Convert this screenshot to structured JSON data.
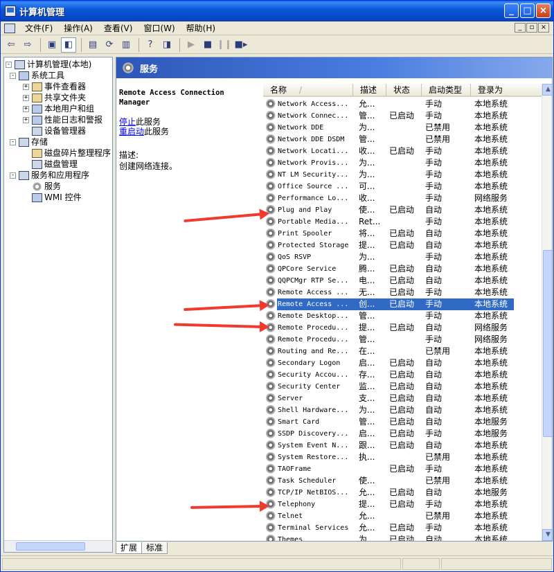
{
  "window": {
    "title": "计算机管理",
    "min": "_",
    "max": "□",
    "close": "×"
  },
  "menu": {
    "items": [
      "文件(F)",
      "操作(A)",
      "查看(V)",
      "窗口(W)",
      "帮助(H)"
    ],
    "mdi": [
      "_",
      "▫",
      "×"
    ]
  },
  "toolbar": {
    "icons": [
      "back-arrow-icon",
      "forward-arrow-icon",
      "up-folder-icon",
      "show-hide-tree-icon",
      "properties-icon",
      "refresh-icon",
      "export-list-icon",
      "help-icon",
      "description-icon",
      "start-icon",
      "stop-icon",
      "pause-icon",
      "restart-icon"
    ]
  },
  "tree": {
    "items": [
      {
        "label": "计算机管理(本地)",
        "icon": "computer-icon",
        "toggle": "-"
      },
      {
        "label": "系统工具",
        "icon": "tools-icon",
        "toggle": "-"
      },
      {
        "label": "事件查看器",
        "icon": "event-viewer-icon",
        "toggle": "+"
      },
      {
        "label": "共享文件夹",
        "icon": "shared-folder-icon",
        "toggle": "+"
      },
      {
        "label": "本地用户和组",
        "icon": "users-icon",
        "toggle": "+"
      },
      {
        "label": "性能日志和警报",
        "icon": "performance-icon",
        "toggle": "+"
      },
      {
        "label": "设备管理器",
        "icon": "device-manager-icon",
        "toggle": ""
      },
      {
        "label": "存储",
        "icon": "storage-icon",
        "toggle": "-"
      },
      {
        "label": "磁盘碎片整理程序",
        "icon": "defrag-icon",
        "toggle": ""
      },
      {
        "label": "磁盘管理",
        "icon": "disk-icon",
        "toggle": ""
      },
      {
        "label": "服务和应用程序",
        "icon": "services-apps-icon",
        "toggle": "-"
      },
      {
        "label": "服务",
        "icon": "gear-icon",
        "toggle": ""
      },
      {
        "label": "WMI 控件",
        "icon": "wmi-icon",
        "toggle": ""
      }
    ]
  },
  "header": {
    "title": "服务"
  },
  "desc": {
    "title": "Remote Access Connection Manager",
    "stop_link": "停止",
    "stop_rest": "此服务",
    "restart_link": "重启动",
    "restart_rest": "此服务",
    "label": "描述:",
    "text": "创建网络连接。"
  },
  "columns": [
    "名称",
    "描述",
    "状态",
    "启动类型",
    "登录为"
  ],
  "sort_indicator": "/",
  "services": [
    {
      "name": "Network Access...",
      "desc": "允...",
      "status": "",
      "start": "手动",
      "logon": "本地系统"
    },
    {
      "name": "Network Connec...",
      "desc": "管...",
      "status": "已启动",
      "start": "手动",
      "logon": "本地系统"
    },
    {
      "name": "Network DDE",
      "desc": "为...",
      "status": "",
      "start": "已禁用",
      "logon": "本地系统"
    },
    {
      "name": "Network DDE DSDM",
      "desc": "管...",
      "status": "",
      "start": "已禁用",
      "logon": "本地系统"
    },
    {
      "name": "Network Locati...",
      "desc": "收...",
      "status": "已启动",
      "start": "手动",
      "logon": "本地系统"
    },
    {
      "name": "Network Provis...",
      "desc": "为...",
      "status": "",
      "start": "手动",
      "logon": "本地系统"
    },
    {
      "name": "NT LM Security...",
      "desc": "为...",
      "status": "",
      "start": "手动",
      "logon": "本地系统"
    },
    {
      "name": "Office Source ...",
      "desc": "可...",
      "status": "",
      "start": "手动",
      "logon": "本地系统"
    },
    {
      "name": "Performance Lo...",
      "desc": "收...",
      "status": "",
      "start": "手动",
      "logon": "网络服务"
    },
    {
      "name": "Plug and Play",
      "desc": "使...",
      "status": "已启动",
      "start": "自动",
      "logon": "本地系统"
    },
    {
      "name": "Portable Media...",
      "desc": "Ret...",
      "status": "",
      "start": "手动",
      "logon": "本地系统"
    },
    {
      "name": "Print Spooler",
      "desc": "将...",
      "status": "已启动",
      "start": "自动",
      "logon": "本地系统"
    },
    {
      "name": "Protected Storage",
      "desc": "提...",
      "status": "已启动",
      "start": "自动",
      "logon": "本地系统"
    },
    {
      "name": "QoS RSVP",
      "desc": "为...",
      "status": "",
      "start": "手动",
      "logon": "本地系统"
    },
    {
      "name": "QPCore Service",
      "desc": "腾...",
      "status": "已启动",
      "start": "自动",
      "logon": "本地系统"
    },
    {
      "name": "QQPCMgr RTP Se...",
      "desc": "电...",
      "status": "已启动",
      "start": "自动",
      "logon": "本地系统"
    },
    {
      "name": "Remote Access ...",
      "desc": "无...",
      "status": "已启动",
      "start": "手动",
      "logon": "本地系统"
    },
    {
      "name": "Remote Access ...",
      "desc": "创...",
      "status": "已启动",
      "start": "手动",
      "logon": "本地系统"
    },
    {
      "name": "Remote Desktop...",
      "desc": "管...",
      "status": "",
      "start": "手动",
      "logon": "本地系统"
    },
    {
      "name": "Remote Procedu...",
      "desc": "提...",
      "status": "已启动",
      "start": "自动",
      "logon": "网络服务"
    },
    {
      "name": "Remote Procedu...",
      "desc": "管...",
      "status": "",
      "start": "手动",
      "logon": "网络服务"
    },
    {
      "name": "Routing and Re...",
      "desc": "在...",
      "status": "",
      "start": "已禁用",
      "logon": "本地系统"
    },
    {
      "name": "Secondary Logon",
      "desc": "启...",
      "status": "已启动",
      "start": "自动",
      "logon": "本地系统"
    },
    {
      "name": "Security Accou...",
      "desc": "存...",
      "status": "已启动",
      "start": "自动",
      "logon": "本地系统"
    },
    {
      "name": "Security Center",
      "desc": "监...",
      "status": "已启动",
      "start": "自动",
      "logon": "本地系统"
    },
    {
      "name": "Server",
      "desc": "支...",
      "status": "已启动",
      "start": "自动",
      "logon": "本地系统"
    },
    {
      "name": "Shell Hardware...",
      "desc": "为...",
      "status": "已启动",
      "start": "自动",
      "logon": "本地系统"
    },
    {
      "name": "Smart Card",
      "desc": "管...",
      "status": "已启动",
      "start": "自动",
      "logon": "本地服务"
    },
    {
      "name": "SSDP Discovery...",
      "desc": "启...",
      "status": "已启动",
      "start": "手动",
      "logon": "本地服务"
    },
    {
      "name": "System Event N...",
      "desc": "跟...",
      "status": "已启动",
      "start": "自动",
      "logon": "本地系统"
    },
    {
      "name": "System Restore...",
      "desc": "执...",
      "status": "",
      "start": "已禁用",
      "logon": "本地系统"
    },
    {
      "name": "TAOFrame",
      "desc": "",
      "status": "已启动",
      "start": "手动",
      "logon": "本地系统"
    },
    {
      "name": "Task Scheduler",
      "desc": "使...",
      "status": "",
      "start": "已禁用",
      "logon": "本地系统"
    },
    {
      "name": "TCP/IP NetBIOS...",
      "desc": "允...",
      "status": "已启动",
      "start": "自动",
      "logon": "本地服务"
    },
    {
      "name": "Telephony",
      "desc": "提...",
      "status": "已启动",
      "start": "手动",
      "logon": "本地系统"
    },
    {
      "name": "Telnet",
      "desc": "允...",
      "status": "",
      "start": "已禁用",
      "logon": "本地系统"
    },
    {
      "name": "Terminal Services",
      "desc": "允...",
      "status": "已启动",
      "start": "手动",
      "logon": "本地系统"
    },
    {
      "name": "Themes",
      "desc": "为...",
      "status": "已启动",
      "start": "自动",
      "logon": "本地系统"
    }
  ],
  "selected_row": "Remote Access Connection Manager",
  "tabs": [
    "扩展",
    "标准"
  ],
  "colors": {
    "selection": "#316ac5",
    "title_bar": "#0a58d8",
    "annotation_arrow": "#f03a2e"
  }
}
